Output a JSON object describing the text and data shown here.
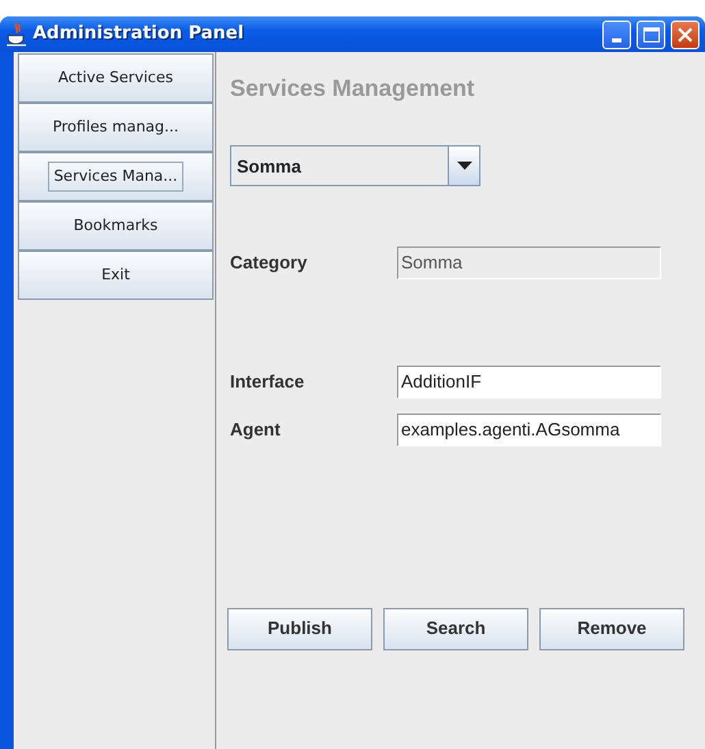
{
  "window": {
    "title": "Administration Panel"
  },
  "sidebar": {
    "items": [
      {
        "label": "Active Services",
        "selected": false
      },
      {
        "label": "Profiles manag...",
        "selected": false
      },
      {
        "label": "Services Mana...",
        "selected": true
      },
      {
        "label": "Bookmarks",
        "selected": false
      },
      {
        "label": "Exit",
        "selected": false
      }
    ]
  },
  "panel": {
    "title": "Services Management",
    "combo": {
      "value": "Somma"
    },
    "fields": [
      {
        "label": "Category",
        "value": "Somma",
        "disabled": true
      },
      {
        "label": "Interface",
        "value": "AdditionIF",
        "disabled": false
      },
      {
        "label": "Agent",
        "value": "examples.agenti.AGsomma",
        "disabled": false
      }
    ],
    "buttons": [
      "Publish",
      "Search",
      "Remove"
    ]
  }
}
